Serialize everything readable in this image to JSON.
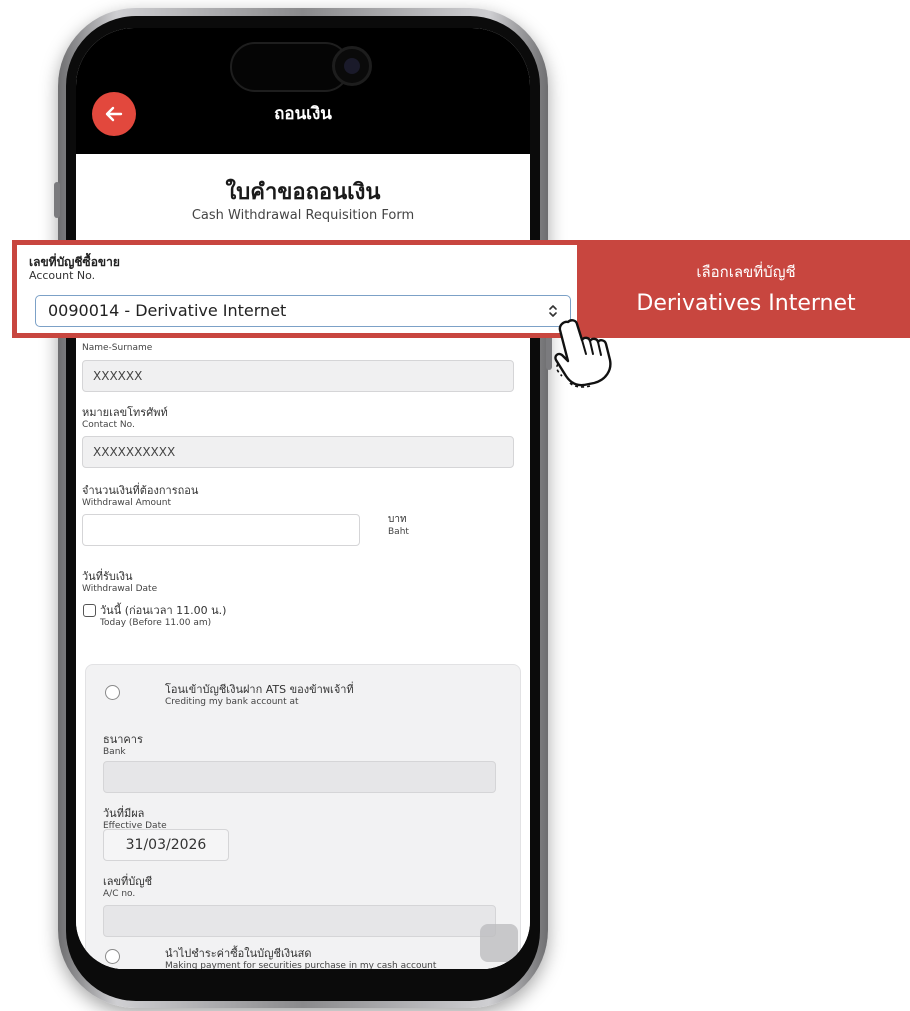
{
  "header": {
    "title": "ถอนเงิน"
  },
  "form": {
    "title": "ใบคำขอถอนเงิน",
    "subtitle": "Cash Withdrawal Requisition Form",
    "account": {
      "label_th": "เลขที่บัญชีซื้อขาย",
      "label_en": "Account No.",
      "selected": "0090014 - Derivative Internet"
    },
    "name": {
      "label_en": "Name-Surname",
      "value": "XXXXXX"
    },
    "phone": {
      "label_th": "หมายเลขโทรศัพท์",
      "label_en": "Contact No.",
      "value": "XXXXXXXXXX"
    },
    "amount": {
      "label_th": "จำนวนเงินที่ต้องการถอน",
      "label_en": "Withdrawal Amount",
      "value": "",
      "unit_th": "บาท",
      "unit_en": "Baht"
    },
    "date": {
      "label_th": "วันที่รับเงิน",
      "label_en": "Withdrawal Date",
      "today_th": "วันนี้ (ก่อนเวลา 11.00 น.)",
      "today_en": "Today (Before 11.00 am)"
    },
    "option1": {
      "label_th": "โอนเข้าบัญชีเงินฝาก ATS ของข้าพเจ้าที่",
      "label_en": "Crediting my bank account at"
    },
    "bank": {
      "label_th": "ธนาคาร",
      "label_en": "Bank",
      "value": ""
    },
    "effective_date": {
      "label_th": "วันที่มีผล",
      "label_en": "Effective Date",
      "value": "31/03/2026"
    },
    "ac_no": {
      "label_th": "เลขที่บัญชี",
      "label_en": "A/C no.",
      "value": ""
    },
    "option2": {
      "label_th": "นำไปชำระค่าซื้อในบัญชีเงินสด",
      "label_en": "Making payment for securities purchase in my cash account"
    }
  },
  "annotation": {
    "line1": "เลือกเลขที่บัญชี",
    "line2": "Derivatives Internet"
  },
  "colors": {
    "accent": "#c8463f",
    "back_button": "#e2483d",
    "select_border": "#7ca1c7"
  },
  "icons": {
    "back": "arrow-left-icon",
    "select": "chevron-updown-icon",
    "pointer": "hand-pointer-icon"
  }
}
